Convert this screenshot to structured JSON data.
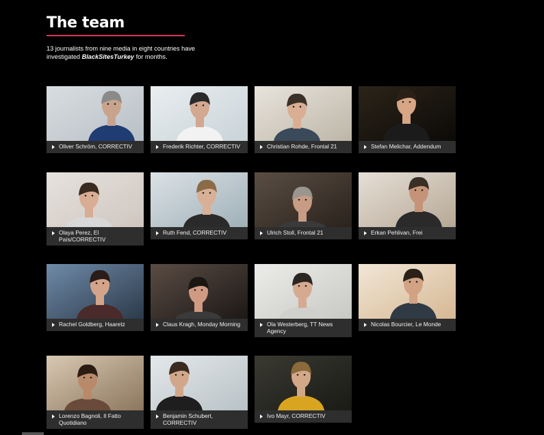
{
  "page": {
    "title": "The team",
    "intro_part1": "13 journalists from nine media in eight countries have investigated ",
    "intro_brand": "BlackSitesTurkey",
    "intro_part2": " for months.",
    "accent_color": "#e0305a"
  },
  "members": [
    {
      "name": "Oliver Schröm, CORRECTIV",
      "icon": "portrait-photo"
    },
    {
      "name": "Frederik Richter, CORRECTIV",
      "icon": "portrait-photo"
    },
    {
      "name": "Christian Rohde, Frontal 21",
      "icon": "portrait-photo"
    },
    {
      "name": "Stefan Melichar, Addendum",
      "icon": "portrait-photo"
    },
    {
      "name": "Olaya Perez, El País/CORRECTIV",
      "icon": "portrait-photo"
    },
    {
      "name": "Ruth Fend, CORRECTIV",
      "icon": "portrait-photo"
    },
    {
      "name": "Ulrich Stoll, Frontal 21",
      "icon": "portrait-photo"
    },
    {
      "name": "Erkan Pehlivan, Frei",
      "icon": "portrait-photo"
    },
    {
      "name": "Rachel Goldberg, Haaretz",
      "icon": "portrait-photo"
    },
    {
      "name": "Claus Kragh, Monday Morning",
      "icon": "portrait-photo"
    },
    {
      "name": "Ola Westerberg, TT News Agency",
      "icon": "portrait-photo"
    },
    {
      "name": "Nicolas Bourcier, Le Monde",
      "icon": "portrait-photo"
    },
    {
      "name": "Lorenzo Bagnoli, Il Fatto Quotidiano",
      "icon": "portrait-photo"
    },
    {
      "name": "Benjamin Schubert, CORRECTIV",
      "icon": "portrait-photo"
    },
    {
      "name": "Ivo Mayr, CORRECTIV",
      "icon": "portrait-photo"
    }
  ]
}
